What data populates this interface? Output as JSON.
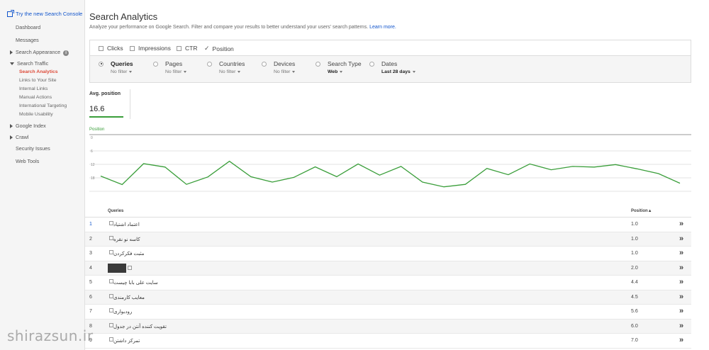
{
  "sidebar": {
    "promo": "Try the new Search Console",
    "dashboard": "Dashboard",
    "messages": "Messages",
    "search_appearance": "Search Appearance",
    "search_traffic": "Search Traffic",
    "traffic_items": [
      "Search Analytics",
      "Links to Your Site",
      "Internal Links",
      "Manual Actions",
      "International Targeting",
      "Mobile Usability"
    ],
    "google_index": "Google Index",
    "crawl": "Crawl",
    "security": "Security Issues",
    "web_tools": "Web Tools"
  },
  "header": {
    "title": "Search Analytics",
    "description": "Analyze your performance on Google Search. Filter and compare your results to better understand your users' search patterns.",
    "learn_more": "Learn more."
  },
  "metrics": {
    "clicks": "Clicks",
    "impressions": "Impressions",
    "ctr": "CTR",
    "position": "Position"
  },
  "dimensions": {
    "queries": {
      "label": "Queries",
      "filter": "No filter"
    },
    "pages": {
      "label": "Pages",
      "filter": "No filter"
    },
    "countries": {
      "label": "Countries",
      "filter": "No filter"
    },
    "devices": {
      "label": "Devices",
      "filter": "No filter"
    },
    "search_type": {
      "label": "Search Type",
      "filter": "Web"
    },
    "dates": {
      "label": "Dates",
      "filter": "Last 28 days"
    }
  },
  "summary": {
    "label": "Avg. position",
    "value": "16.6"
  },
  "chart_data": {
    "type": "line",
    "title": "Position",
    "y_ticks": [
      "0",
      "6",
      "12",
      "18"
    ],
    "ylim": [
      0,
      24
    ],
    "y_inverted": true,
    "line_color": "#3a9e3a",
    "series": [
      {
        "name": "Position",
        "values": [
          17.2,
          21.0,
          11.7,
          13.2,
          20.9,
          17.6,
          10.6,
          17.5,
          19.9,
          17.8,
          13.1,
          17.5,
          11.8,
          16.8,
          12.9,
          19.9,
          22.0,
          20.9,
          13.8,
          16.6,
          11.8,
          14.4,
          12.9,
          13.2,
          12.1,
          14.0,
          16.1,
          20.4
        ]
      }
    ]
  },
  "table": {
    "col_queries": "Queries",
    "col_position": "Position▲",
    "rows": [
      {
        "n": "1",
        "q": "اعتماد اشتیاد",
        "p": "1.0"
      },
      {
        "n": "2",
        "q": "کاسه نو نقره",
        "p": "1.0"
      },
      {
        "n": "3",
        "q": "مثبت فکرکردن",
        "p": "1.0"
      },
      {
        "n": "4",
        "q": "",
        "p": "2.0"
      },
      {
        "n": "5",
        "q": "سایت علی بابا چیست",
        "p": "4.4"
      },
      {
        "n": "6",
        "q": "معایب کارمندی",
        "p": "4.5"
      },
      {
        "n": "7",
        "q": "رودبواری",
        "p": "5.6"
      },
      {
        "n": "8",
        "q": "تقویت کننده آنتن در جدول",
        "p": "6.0"
      },
      {
        "n": "9",
        "q": "تمرکز داشتن",
        "p": "7.0"
      }
    ]
  },
  "watermark": "shirazsun.ir"
}
